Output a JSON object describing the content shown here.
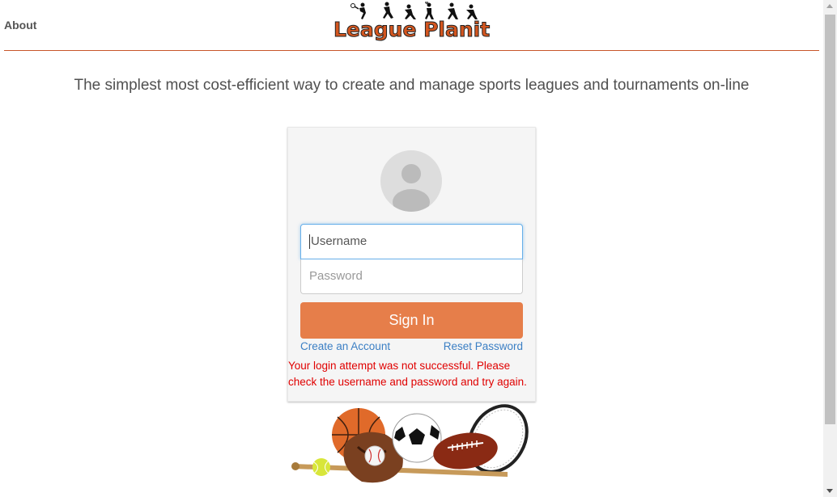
{
  "header": {
    "about_label": "About",
    "logo_text": "League Planit"
  },
  "tagline": "The simplest most cost-efficient way to create and manage sports leagues and tournaments on-line",
  "login": {
    "username_placeholder": "Username",
    "password_placeholder": "Password",
    "signin_label": "Sign In",
    "create_account_label": "Create an Account",
    "reset_password_label": "Reset Password",
    "error_message": "Your login attempt was not successful. Please check the username and password and try again."
  },
  "colors": {
    "accent": "#e67e4a",
    "link": "#3b7fc4",
    "error": "#e00000",
    "header_rule": "#c8562a"
  },
  "icons": {
    "avatar": "user-avatar-icon",
    "sports": "sports-equipment-image"
  }
}
